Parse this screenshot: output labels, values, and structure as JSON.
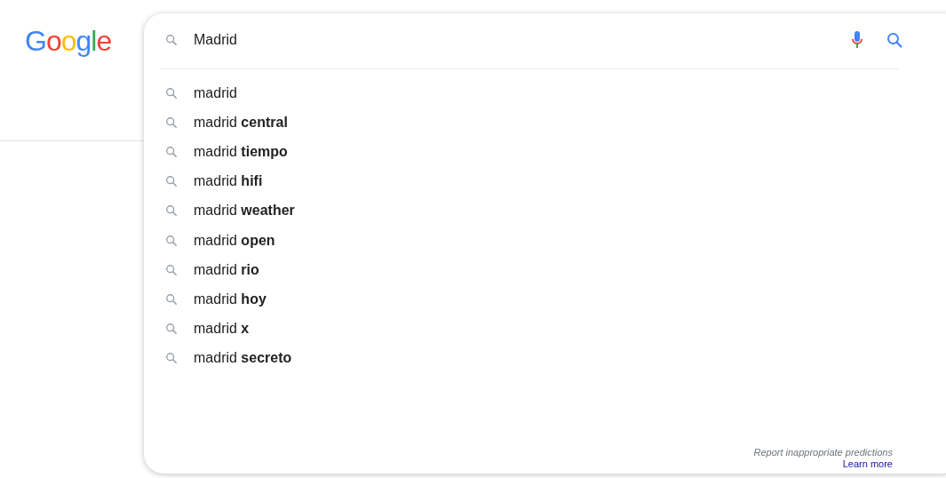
{
  "logo": {
    "text": "Google"
  },
  "search": {
    "value": "Madrid"
  },
  "suggestions": [
    {
      "text": "madrid"
    },
    {
      "text": "madrid **central**"
    },
    {
      "text": "madrid **tiempo**"
    },
    {
      "text": "madrid **hifi**"
    },
    {
      "text": "madrid **weather**"
    },
    {
      "text": "madrid **open**"
    },
    {
      "text": "madrid **rio**"
    },
    {
      "text": "madrid **hoy**"
    },
    {
      "text": "madrid **x**"
    },
    {
      "text": "madrid **secreto**"
    }
  ],
  "footer": {
    "report": "Report inappropriate predictions",
    "learn_more": "Learn more"
  }
}
